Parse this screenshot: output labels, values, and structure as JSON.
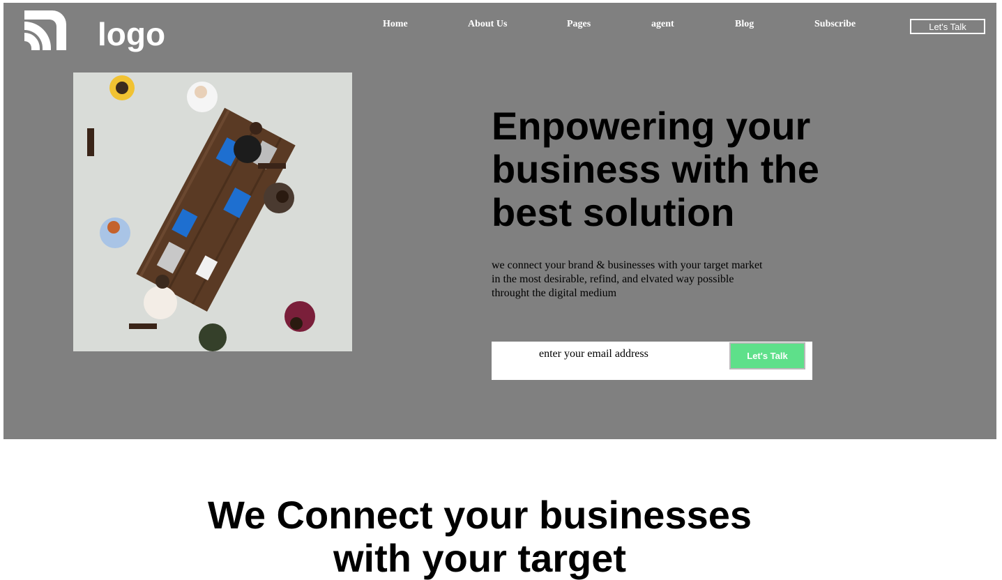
{
  "header": {
    "logo_text": "logo",
    "nav": [
      "Home",
      "About Us",
      "Pages",
      "agent",
      "Blog",
      "Subscribe"
    ],
    "cta_label": "Let's Talk"
  },
  "hero": {
    "title": "Enpowering your business with the best solution",
    "subtitle_lines": [
      "we connect your brand & businesses with your target market",
      "in the most desirable, refind, and elvated way possible",
      "throught the digital medium"
    ],
    "email_placeholder": "enter your email address",
    "form_button": "Let's Talk",
    "image_icon": "team-meeting-photo"
  },
  "section": {
    "title_lines": [
      "We Connect your businesses",
      "with your target"
    ]
  },
  "colors": {
    "hero_bg": "#808080",
    "accent_button": "#5ee08a",
    "text_light": "#ffffff",
    "text_dark": "#000000"
  }
}
